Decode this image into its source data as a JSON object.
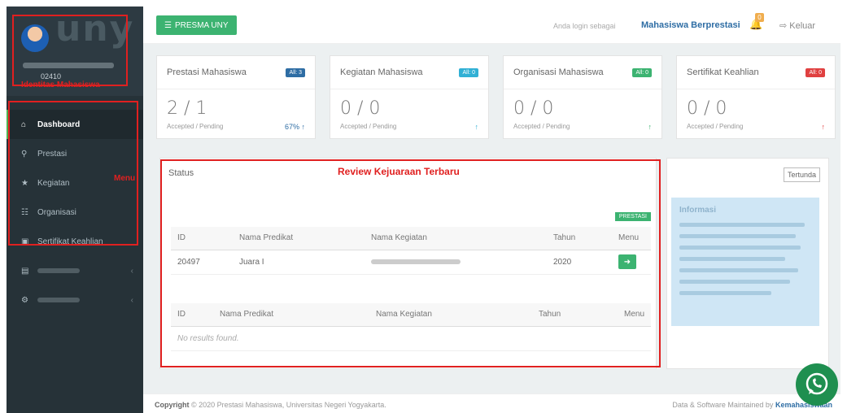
{
  "sidebar": {
    "user_nim": "02410",
    "identity_note": "Identitas Mahasiswa",
    "menu_note": "Menu",
    "items": [
      {
        "label": "Dashboard",
        "icon": "home-icon"
      },
      {
        "label": "Prestasi",
        "icon": "trophy-icon"
      },
      {
        "label": "Kegiatan",
        "icon": "star-icon"
      },
      {
        "label": "Organisasi",
        "icon": "sitemap-icon"
      },
      {
        "label": "Sertifikat Keahlian",
        "icon": "certificate-icon"
      }
    ]
  },
  "topbar": {
    "brand": "PRESMA UNY",
    "login_label": "Anda login sebagai",
    "login_user": "Mahasiswa Berprestasi",
    "notif_count": "0",
    "logout": "Keluar"
  },
  "stats": [
    {
      "title": "Prestasi Mahasiswa",
      "badge": "All: 3",
      "badge_color": "#2e6da4",
      "value": "2 / 1",
      "sub": "Accepted / Pending",
      "pct": "67% ↑",
      "pct_color": "#2e6da4"
    },
    {
      "title": "Kegiatan Mahasiswa",
      "badge": "All: 0",
      "badge_color": "#31b0d5",
      "value": "0 / 0",
      "sub": "Accepted / Pending",
      "pct": "↑",
      "pct_color": "#31b0d5"
    },
    {
      "title": "Organisasi Mahasiswa",
      "badge": "All: 0",
      "badge_color": "#3cb371",
      "value": "0 / 0",
      "sub": "Accepted / Pending",
      "pct": "↑",
      "pct_color": "#3cb371"
    },
    {
      "title": "Sertifikat Keahlian",
      "badge": "All: 0",
      "badge_color": "#e04040",
      "value": "0 / 0",
      "sub": "Accepted / Pending",
      "pct": "↑",
      "pct_color": "#e04040"
    }
  ],
  "status": {
    "title": "Status",
    "review_note": "Review Kejuaraan Terbaru",
    "badge": "PRESTASI",
    "table1": {
      "headers": [
        "ID",
        "Nama Predikat",
        "Nama Kegiatan",
        "Tahun",
        "Menu"
      ],
      "rows": [
        {
          "id": "20497",
          "predikat": "Juara I",
          "tahun": "2020"
        }
      ]
    },
    "table2": {
      "headers": [
        "ID",
        "Nama Predikat",
        "Nama Kegiatan",
        "Tahun",
        "Menu"
      ],
      "empty": "No results found."
    }
  },
  "right": {
    "tertunda": "Tertunda",
    "info_title": "Informasi"
  },
  "footer": {
    "copyright_label": "Copyright",
    "copyright_text": "© 2020 Prestasi Mahasiswa, Universitas Negeri Yogyakarta.",
    "right_text": "Data & Software Maintained by",
    "right_link": "Kemahasiswaan"
  }
}
